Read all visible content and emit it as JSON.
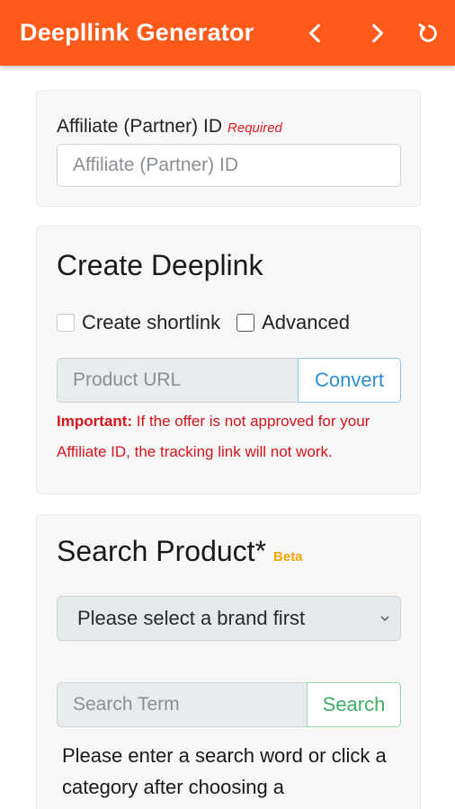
{
  "appbar": {
    "title": "Deepllink Generator",
    "back_icon": "chevron-left-icon",
    "forward_icon": "chevron-right-icon",
    "reload_icon": "reload-icon"
  },
  "affiliate": {
    "label": "Affiliate (Partner) ID",
    "required": "Required",
    "placeholder": "Affiliate (Partner) ID"
  },
  "deeplink": {
    "heading": "Create Deeplink",
    "shortlink_label": "Create shortlink",
    "advanced_label": "Advanced",
    "url_placeholder": "Product URL",
    "convert_label": "Convert",
    "important_label": "Important:",
    "important_text": " If the offer is not approved for your Affiliate ID, the tracking link will not work."
  },
  "search": {
    "heading": "Search Product*",
    "beta": "Beta",
    "brand_select": "Please select a brand first",
    "term_placeholder": "Search Term",
    "search_label": "Search",
    "help_text": "Please enter a search word or click a category after choosing a"
  },
  "colors": {
    "appbar": "#ff5a1a",
    "required": "#e01d1d",
    "convert": "#2c8fd6",
    "search": "#3fae66",
    "beta": "#f0a500"
  }
}
